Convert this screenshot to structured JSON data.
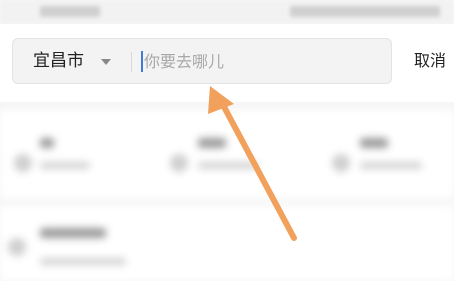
{
  "search": {
    "city": "宜昌市",
    "placeholder": "你要去哪儿",
    "value": ""
  },
  "header": {
    "cancel_label": "取消"
  },
  "colors": {
    "cursor": "#3f7ad8",
    "arrow": "#f1a15b"
  }
}
